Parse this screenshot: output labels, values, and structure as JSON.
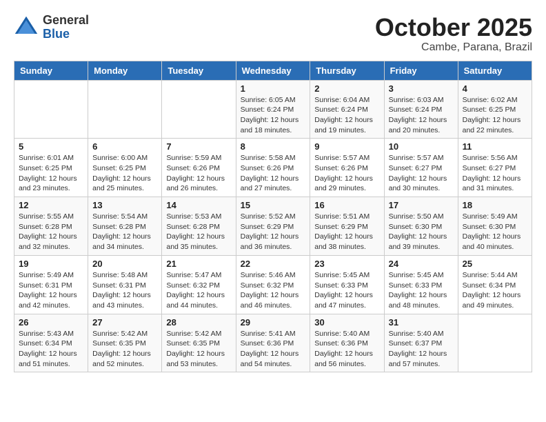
{
  "logo": {
    "general": "General",
    "blue": "Blue"
  },
  "header": {
    "month": "October 2025",
    "location": "Cambe, Parana, Brazil"
  },
  "days_of_week": [
    "Sunday",
    "Monday",
    "Tuesday",
    "Wednesday",
    "Thursday",
    "Friday",
    "Saturday"
  ],
  "weeks": [
    [
      {
        "day": "",
        "info": ""
      },
      {
        "day": "",
        "info": ""
      },
      {
        "day": "",
        "info": ""
      },
      {
        "day": "1",
        "info": "Sunrise: 6:05 AM\nSunset: 6:24 PM\nDaylight: 12 hours\nand 18 minutes."
      },
      {
        "day": "2",
        "info": "Sunrise: 6:04 AM\nSunset: 6:24 PM\nDaylight: 12 hours\nand 19 minutes."
      },
      {
        "day": "3",
        "info": "Sunrise: 6:03 AM\nSunset: 6:24 PM\nDaylight: 12 hours\nand 20 minutes."
      },
      {
        "day": "4",
        "info": "Sunrise: 6:02 AM\nSunset: 6:25 PM\nDaylight: 12 hours\nand 22 minutes."
      }
    ],
    [
      {
        "day": "5",
        "info": "Sunrise: 6:01 AM\nSunset: 6:25 PM\nDaylight: 12 hours\nand 23 minutes."
      },
      {
        "day": "6",
        "info": "Sunrise: 6:00 AM\nSunset: 6:25 PM\nDaylight: 12 hours\nand 25 minutes."
      },
      {
        "day": "7",
        "info": "Sunrise: 5:59 AM\nSunset: 6:26 PM\nDaylight: 12 hours\nand 26 minutes."
      },
      {
        "day": "8",
        "info": "Sunrise: 5:58 AM\nSunset: 6:26 PM\nDaylight: 12 hours\nand 27 minutes."
      },
      {
        "day": "9",
        "info": "Sunrise: 5:57 AM\nSunset: 6:26 PM\nDaylight: 12 hours\nand 29 minutes."
      },
      {
        "day": "10",
        "info": "Sunrise: 5:57 AM\nSunset: 6:27 PM\nDaylight: 12 hours\nand 30 minutes."
      },
      {
        "day": "11",
        "info": "Sunrise: 5:56 AM\nSunset: 6:27 PM\nDaylight: 12 hours\nand 31 minutes."
      }
    ],
    [
      {
        "day": "12",
        "info": "Sunrise: 5:55 AM\nSunset: 6:28 PM\nDaylight: 12 hours\nand 32 minutes."
      },
      {
        "day": "13",
        "info": "Sunrise: 5:54 AM\nSunset: 6:28 PM\nDaylight: 12 hours\nand 34 minutes."
      },
      {
        "day": "14",
        "info": "Sunrise: 5:53 AM\nSunset: 6:28 PM\nDaylight: 12 hours\nand 35 minutes."
      },
      {
        "day": "15",
        "info": "Sunrise: 5:52 AM\nSunset: 6:29 PM\nDaylight: 12 hours\nand 36 minutes."
      },
      {
        "day": "16",
        "info": "Sunrise: 5:51 AM\nSunset: 6:29 PM\nDaylight: 12 hours\nand 38 minutes."
      },
      {
        "day": "17",
        "info": "Sunrise: 5:50 AM\nSunset: 6:30 PM\nDaylight: 12 hours\nand 39 minutes."
      },
      {
        "day": "18",
        "info": "Sunrise: 5:49 AM\nSunset: 6:30 PM\nDaylight: 12 hours\nand 40 minutes."
      }
    ],
    [
      {
        "day": "19",
        "info": "Sunrise: 5:49 AM\nSunset: 6:31 PM\nDaylight: 12 hours\nand 42 minutes."
      },
      {
        "day": "20",
        "info": "Sunrise: 5:48 AM\nSunset: 6:31 PM\nDaylight: 12 hours\nand 43 minutes."
      },
      {
        "day": "21",
        "info": "Sunrise: 5:47 AM\nSunset: 6:32 PM\nDaylight: 12 hours\nand 44 minutes."
      },
      {
        "day": "22",
        "info": "Sunrise: 5:46 AM\nSunset: 6:32 PM\nDaylight: 12 hours\nand 46 minutes."
      },
      {
        "day": "23",
        "info": "Sunrise: 5:45 AM\nSunset: 6:33 PM\nDaylight: 12 hours\nand 47 minutes."
      },
      {
        "day": "24",
        "info": "Sunrise: 5:45 AM\nSunset: 6:33 PM\nDaylight: 12 hours\nand 48 minutes."
      },
      {
        "day": "25",
        "info": "Sunrise: 5:44 AM\nSunset: 6:34 PM\nDaylight: 12 hours\nand 49 minutes."
      }
    ],
    [
      {
        "day": "26",
        "info": "Sunrise: 5:43 AM\nSunset: 6:34 PM\nDaylight: 12 hours\nand 51 minutes."
      },
      {
        "day": "27",
        "info": "Sunrise: 5:42 AM\nSunset: 6:35 PM\nDaylight: 12 hours\nand 52 minutes."
      },
      {
        "day": "28",
        "info": "Sunrise: 5:42 AM\nSunset: 6:35 PM\nDaylight: 12 hours\nand 53 minutes."
      },
      {
        "day": "29",
        "info": "Sunrise: 5:41 AM\nSunset: 6:36 PM\nDaylight: 12 hours\nand 54 minutes."
      },
      {
        "day": "30",
        "info": "Sunrise: 5:40 AM\nSunset: 6:36 PM\nDaylight: 12 hours\nand 56 minutes."
      },
      {
        "day": "31",
        "info": "Sunrise: 5:40 AM\nSunset: 6:37 PM\nDaylight: 12 hours\nand 57 minutes."
      },
      {
        "day": "",
        "info": ""
      }
    ]
  ]
}
